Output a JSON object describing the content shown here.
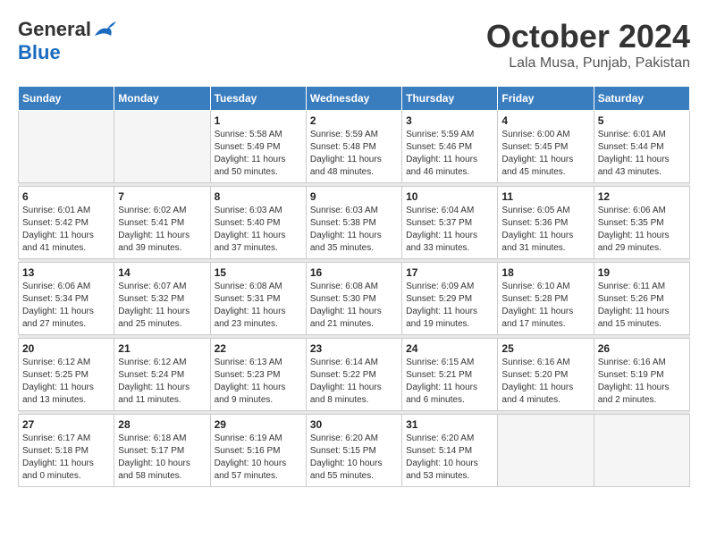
{
  "header": {
    "logo_general": "General",
    "logo_blue": "Blue",
    "month": "October 2024",
    "location": "Lala Musa, Punjab, Pakistan"
  },
  "days_of_week": [
    "Sunday",
    "Monday",
    "Tuesday",
    "Wednesday",
    "Thursday",
    "Friday",
    "Saturday"
  ],
  "weeks": [
    [
      {
        "day": "",
        "empty": true
      },
      {
        "day": "",
        "empty": true
      },
      {
        "day": "1",
        "sunrise": "Sunrise: 5:58 AM",
        "sunset": "Sunset: 5:49 PM",
        "daylight": "Daylight: 11 hours and 50 minutes."
      },
      {
        "day": "2",
        "sunrise": "Sunrise: 5:59 AM",
        "sunset": "Sunset: 5:48 PM",
        "daylight": "Daylight: 11 hours and 48 minutes."
      },
      {
        "day": "3",
        "sunrise": "Sunrise: 5:59 AM",
        "sunset": "Sunset: 5:46 PM",
        "daylight": "Daylight: 11 hours and 46 minutes."
      },
      {
        "day": "4",
        "sunrise": "Sunrise: 6:00 AM",
        "sunset": "Sunset: 5:45 PM",
        "daylight": "Daylight: 11 hours and 45 minutes."
      },
      {
        "day": "5",
        "sunrise": "Sunrise: 6:01 AM",
        "sunset": "Sunset: 5:44 PM",
        "daylight": "Daylight: 11 hours and 43 minutes."
      }
    ],
    [
      {
        "day": "6",
        "sunrise": "Sunrise: 6:01 AM",
        "sunset": "Sunset: 5:42 PM",
        "daylight": "Daylight: 11 hours and 41 minutes."
      },
      {
        "day": "7",
        "sunrise": "Sunrise: 6:02 AM",
        "sunset": "Sunset: 5:41 PM",
        "daylight": "Daylight: 11 hours and 39 minutes."
      },
      {
        "day": "8",
        "sunrise": "Sunrise: 6:03 AM",
        "sunset": "Sunset: 5:40 PM",
        "daylight": "Daylight: 11 hours and 37 minutes."
      },
      {
        "day": "9",
        "sunrise": "Sunrise: 6:03 AM",
        "sunset": "Sunset: 5:38 PM",
        "daylight": "Daylight: 11 hours and 35 minutes."
      },
      {
        "day": "10",
        "sunrise": "Sunrise: 6:04 AM",
        "sunset": "Sunset: 5:37 PM",
        "daylight": "Daylight: 11 hours and 33 minutes."
      },
      {
        "day": "11",
        "sunrise": "Sunrise: 6:05 AM",
        "sunset": "Sunset: 5:36 PM",
        "daylight": "Daylight: 11 hours and 31 minutes."
      },
      {
        "day": "12",
        "sunrise": "Sunrise: 6:06 AM",
        "sunset": "Sunset: 5:35 PM",
        "daylight": "Daylight: 11 hours and 29 minutes."
      }
    ],
    [
      {
        "day": "13",
        "sunrise": "Sunrise: 6:06 AM",
        "sunset": "Sunset: 5:34 PM",
        "daylight": "Daylight: 11 hours and 27 minutes."
      },
      {
        "day": "14",
        "sunrise": "Sunrise: 6:07 AM",
        "sunset": "Sunset: 5:32 PM",
        "daylight": "Daylight: 11 hours and 25 minutes."
      },
      {
        "day": "15",
        "sunrise": "Sunrise: 6:08 AM",
        "sunset": "Sunset: 5:31 PM",
        "daylight": "Daylight: 11 hours and 23 minutes."
      },
      {
        "day": "16",
        "sunrise": "Sunrise: 6:08 AM",
        "sunset": "Sunset: 5:30 PM",
        "daylight": "Daylight: 11 hours and 21 minutes."
      },
      {
        "day": "17",
        "sunrise": "Sunrise: 6:09 AM",
        "sunset": "Sunset: 5:29 PM",
        "daylight": "Daylight: 11 hours and 19 minutes."
      },
      {
        "day": "18",
        "sunrise": "Sunrise: 6:10 AM",
        "sunset": "Sunset: 5:28 PM",
        "daylight": "Daylight: 11 hours and 17 minutes."
      },
      {
        "day": "19",
        "sunrise": "Sunrise: 6:11 AM",
        "sunset": "Sunset: 5:26 PM",
        "daylight": "Daylight: 11 hours and 15 minutes."
      }
    ],
    [
      {
        "day": "20",
        "sunrise": "Sunrise: 6:12 AM",
        "sunset": "Sunset: 5:25 PM",
        "daylight": "Daylight: 11 hours and 13 minutes."
      },
      {
        "day": "21",
        "sunrise": "Sunrise: 6:12 AM",
        "sunset": "Sunset: 5:24 PM",
        "daylight": "Daylight: 11 hours and 11 minutes."
      },
      {
        "day": "22",
        "sunrise": "Sunrise: 6:13 AM",
        "sunset": "Sunset: 5:23 PM",
        "daylight": "Daylight: 11 hours and 9 minutes."
      },
      {
        "day": "23",
        "sunrise": "Sunrise: 6:14 AM",
        "sunset": "Sunset: 5:22 PM",
        "daylight": "Daylight: 11 hours and 8 minutes."
      },
      {
        "day": "24",
        "sunrise": "Sunrise: 6:15 AM",
        "sunset": "Sunset: 5:21 PM",
        "daylight": "Daylight: 11 hours and 6 minutes."
      },
      {
        "day": "25",
        "sunrise": "Sunrise: 6:16 AM",
        "sunset": "Sunset: 5:20 PM",
        "daylight": "Daylight: 11 hours and 4 minutes."
      },
      {
        "day": "26",
        "sunrise": "Sunrise: 6:16 AM",
        "sunset": "Sunset: 5:19 PM",
        "daylight": "Daylight: 11 hours and 2 minutes."
      }
    ],
    [
      {
        "day": "27",
        "sunrise": "Sunrise: 6:17 AM",
        "sunset": "Sunset: 5:18 PM",
        "daylight": "Daylight: 11 hours and 0 minutes."
      },
      {
        "day": "28",
        "sunrise": "Sunrise: 6:18 AM",
        "sunset": "Sunset: 5:17 PM",
        "daylight": "Daylight: 10 hours and 58 minutes."
      },
      {
        "day": "29",
        "sunrise": "Sunrise: 6:19 AM",
        "sunset": "Sunset: 5:16 PM",
        "daylight": "Daylight: 10 hours and 57 minutes."
      },
      {
        "day": "30",
        "sunrise": "Sunrise: 6:20 AM",
        "sunset": "Sunset: 5:15 PM",
        "daylight": "Daylight: 10 hours and 55 minutes."
      },
      {
        "day": "31",
        "sunrise": "Sunrise: 6:20 AM",
        "sunset": "Sunset: 5:14 PM",
        "daylight": "Daylight: 10 hours and 53 minutes."
      },
      {
        "day": "",
        "empty": true
      },
      {
        "day": "",
        "empty": true
      }
    ]
  ]
}
